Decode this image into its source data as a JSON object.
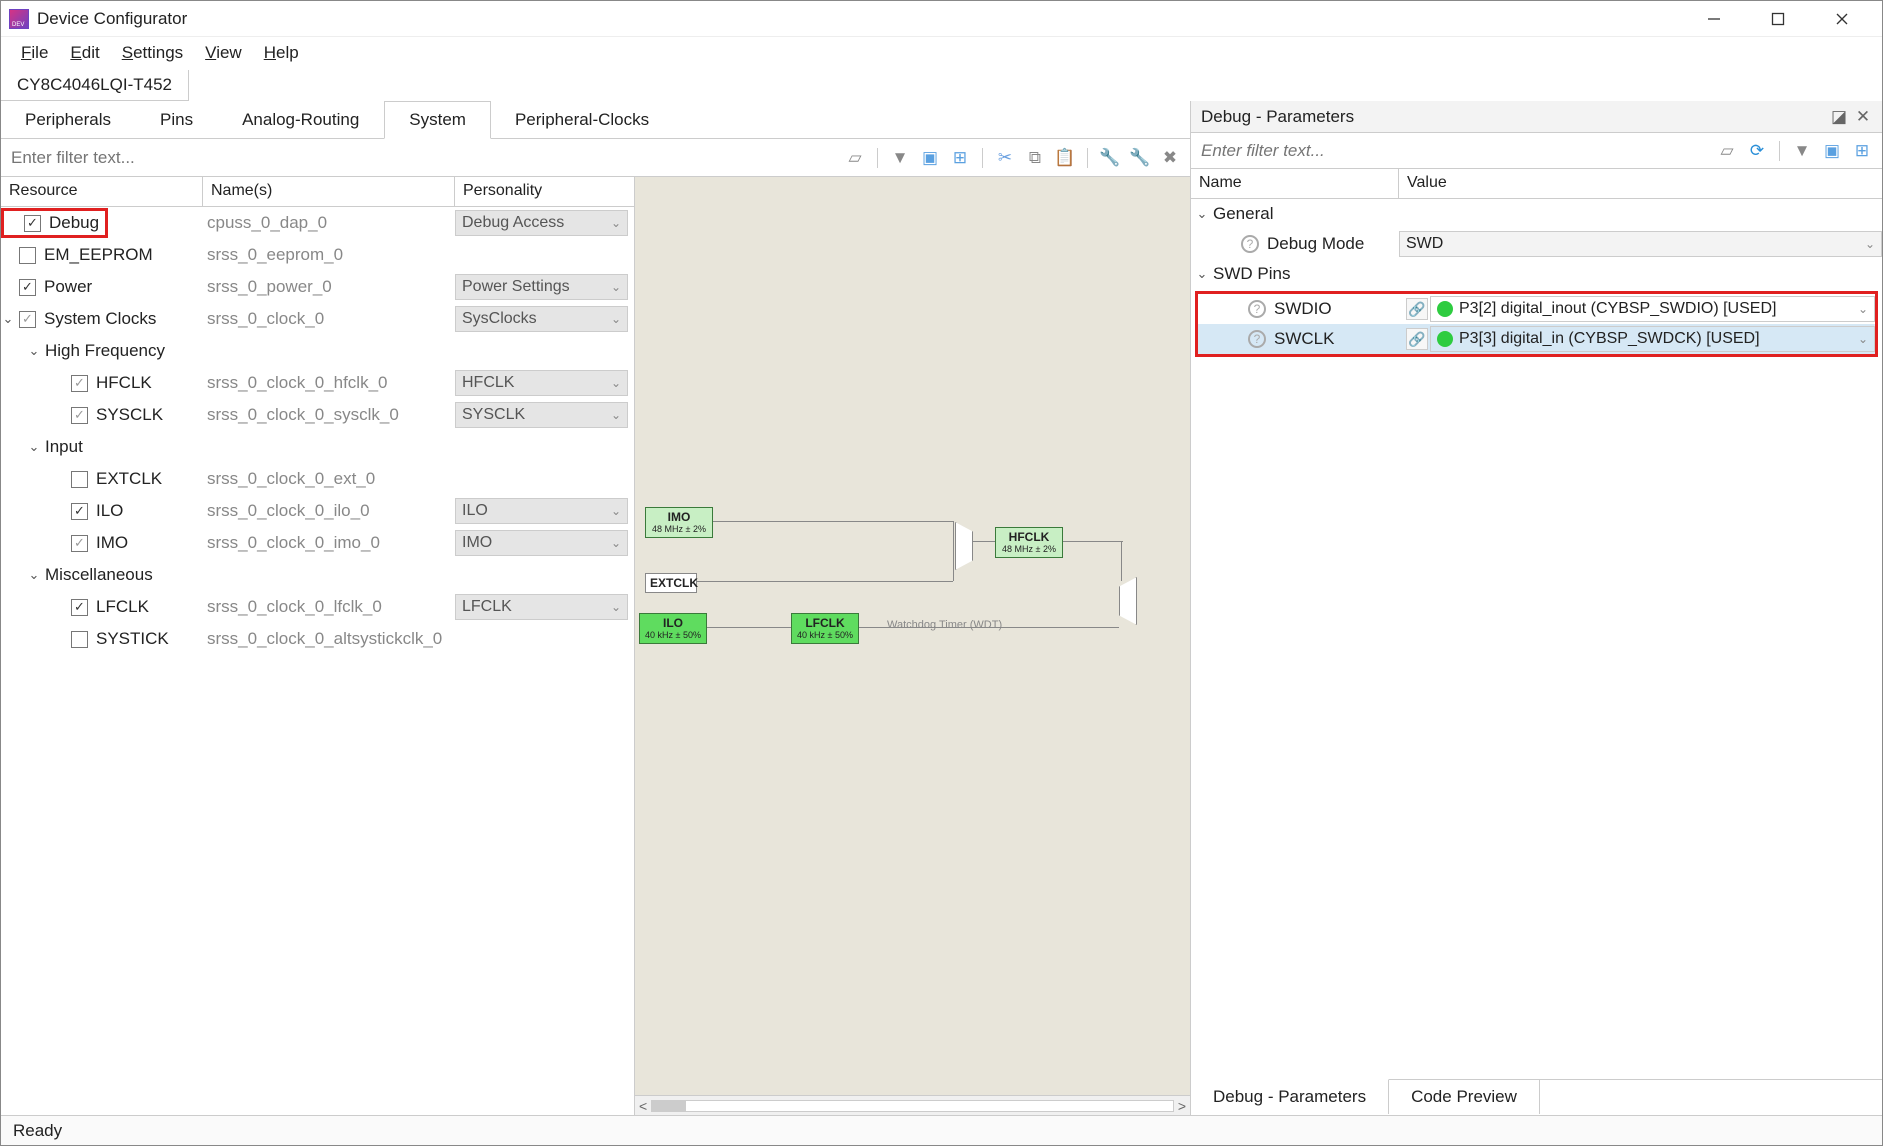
{
  "app": {
    "title": "Device Configurator"
  },
  "menu": {
    "file": "File",
    "edit": "Edit",
    "settings": "Settings",
    "view": "View",
    "help": "Help"
  },
  "device_tab": "CY8C4046LQI-T452",
  "left_tabs": [
    "Peripherals",
    "Pins",
    "Analog-Routing",
    "System",
    "Peripheral-Clocks"
  ],
  "left_active_tab": "System",
  "filter_placeholder": "Enter filter text...",
  "tree_headers": {
    "resource": "Resource",
    "name": "Name(s)",
    "personality": "Personality"
  },
  "tree": [
    {
      "level": 0,
      "caret": "",
      "checkbox": "checked",
      "label": "Debug",
      "name": "cpuss_0_dap_0",
      "personality": "Debug Access",
      "highlight": true
    },
    {
      "level": 0,
      "caret": "",
      "checkbox": "empty",
      "label": "EM_EEPROM",
      "name": "srss_0_eeprom_0",
      "personality": ""
    },
    {
      "level": 0,
      "caret": "",
      "checkbox": "checked",
      "label": "Power",
      "name": "srss_0_power_0",
      "personality": "Power Settings"
    },
    {
      "level": 0,
      "caret": "v",
      "checkbox": "mixed",
      "label": "System Clocks",
      "name": "srss_0_clock_0",
      "personality": "SysClocks",
      "expandable": true
    },
    {
      "level": 1,
      "caret": "v",
      "checkbox": "",
      "label": "High Frequency",
      "name": "",
      "personality": "",
      "expandable": true
    },
    {
      "level": 2,
      "caret": "",
      "checkbox": "mixed",
      "label": "HFCLK",
      "name": "srss_0_clock_0_hfclk_0",
      "personality": "HFCLK"
    },
    {
      "level": 2,
      "caret": "",
      "checkbox": "mixed",
      "label": "SYSCLK",
      "name": "srss_0_clock_0_sysclk_0",
      "personality": "SYSCLK"
    },
    {
      "level": 1,
      "caret": "v",
      "checkbox": "",
      "label": "Input",
      "name": "",
      "personality": "",
      "expandable": true
    },
    {
      "level": 2,
      "caret": "",
      "checkbox": "empty",
      "label": "EXTCLK",
      "name": "srss_0_clock_0_ext_0",
      "personality": ""
    },
    {
      "level": 2,
      "caret": "",
      "checkbox": "checked",
      "label": "ILO",
      "name": "srss_0_clock_0_ilo_0",
      "personality": "ILO"
    },
    {
      "level": 2,
      "caret": "",
      "checkbox": "mixed",
      "label": "IMO",
      "name": "srss_0_clock_0_imo_0",
      "personality": "IMO"
    },
    {
      "level": 1,
      "caret": "v",
      "checkbox": "",
      "label": "Miscellaneous",
      "name": "",
      "personality": "",
      "expandable": true
    },
    {
      "level": 2,
      "caret": "",
      "checkbox": "checked",
      "label": "LFCLK",
      "name": "srss_0_clock_0_lfclk_0",
      "personality": "LFCLK"
    },
    {
      "level": 2,
      "caret": "",
      "checkbox": "empty",
      "label": "SYSTICK",
      "name": "srss_0_clock_0_altsystickclk_0",
      "personality": ""
    }
  ],
  "diagram": {
    "imo": {
      "name": "IMO",
      "sub": "48 MHz ± 2%"
    },
    "extclk": {
      "name": "EXTCLK",
      "sub": ""
    },
    "ilo": {
      "name": "ILO",
      "sub": "40 kHz ± 50%"
    },
    "lfclk": {
      "name": "LFCLK",
      "sub": "40 kHz ± 50%"
    },
    "hfclk": {
      "name": "HFCLK",
      "sub": "48 MHz ± 2%"
    },
    "wdt_label": "Watchdog Timer (WDT)"
  },
  "right_panel": {
    "title": "Debug - Parameters",
    "filter_placeholder": "Enter filter text...",
    "headers": {
      "name": "Name",
      "value": "Value"
    },
    "rows": {
      "general_label": "General",
      "debug_mode_label": "Debug Mode",
      "debug_mode_value": "SWD",
      "swd_pins_label": "SWD Pins",
      "swdio_label": "SWDIO",
      "swdio_value": "P3[2] digital_inout (CYBSP_SWDIO) [USED]",
      "swclk_label": "SWCLK",
      "swclk_value": "P3[3] digital_in (CYBSP_SWDCK) [USED]"
    },
    "tabs": [
      "Debug - Parameters",
      "Code Preview"
    ]
  },
  "status": "Ready"
}
